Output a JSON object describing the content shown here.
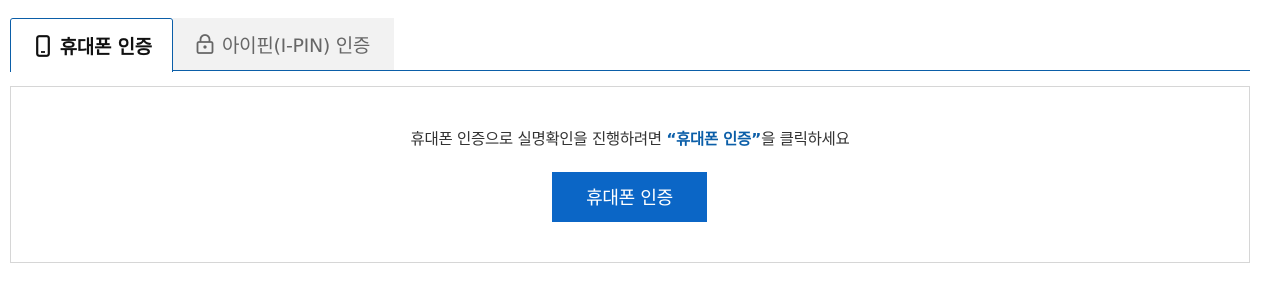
{
  "tabs": [
    {
      "label": "휴대폰 인증",
      "icon": "phone-icon",
      "active": true
    },
    {
      "label": "아이핀(I-PIN) 인증",
      "icon": "lock-icon",
      "active": false
    }
  ],
  "panel": {
    "message_prefix": "휴대폰 인증으로 실명확인을 진행하려면 ",
    "message_highlight": "“휴대폰 인증”",
    "message_suffix": "을 클릭하세요",
    "button_label": "휴대폰 인증"
  },
  "colors": {
    "accent": "#0b5ea8",
    "button": "#0b66c6",
    "inactive_tab_bg": "#f2f2f2",
    "panel_border": "#d6d6d6"
  }
}
